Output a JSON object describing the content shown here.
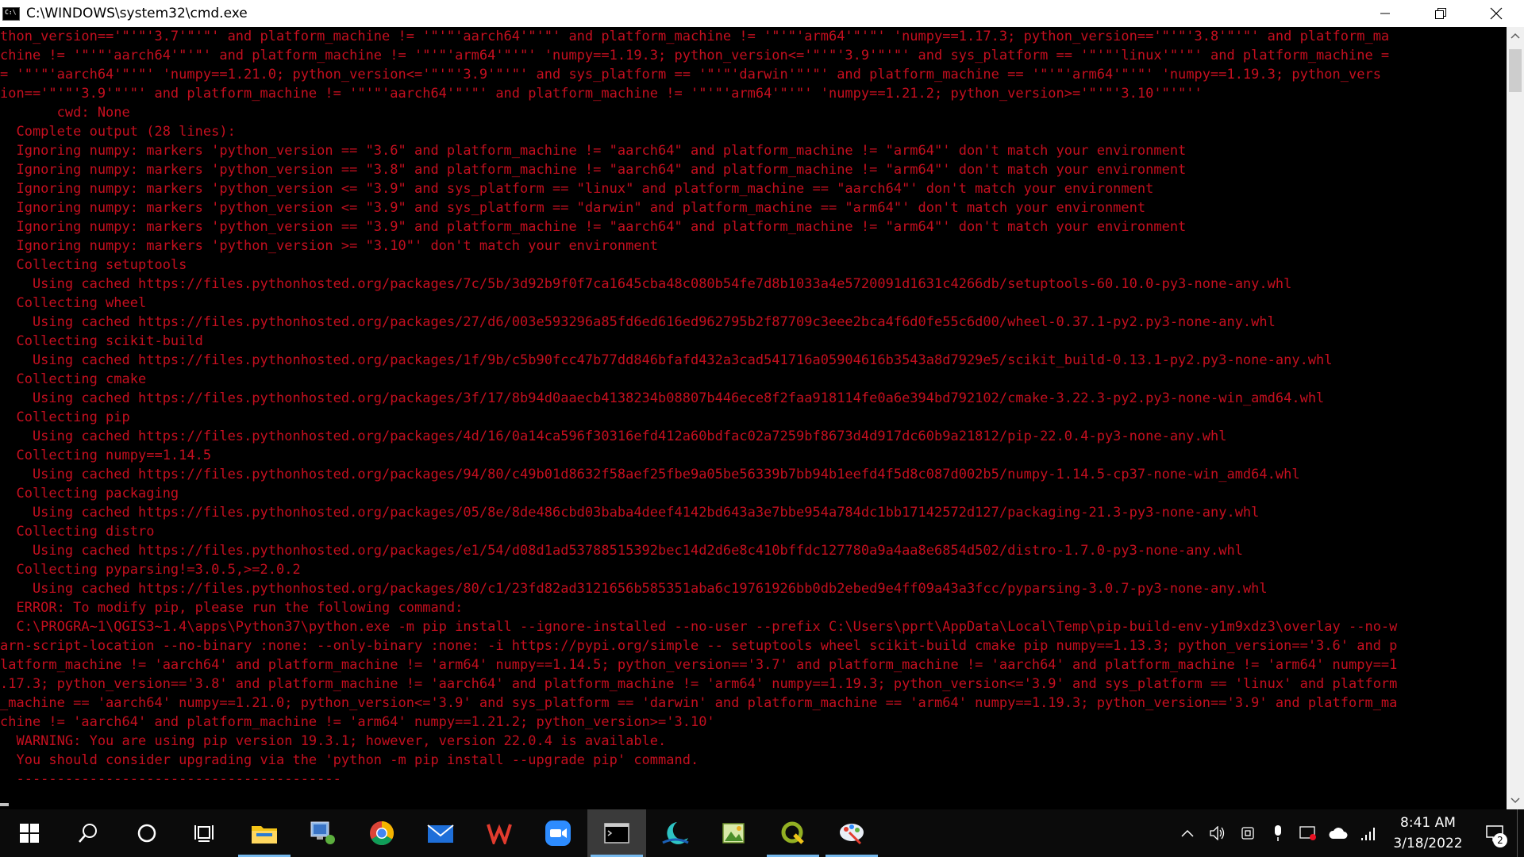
{
  "window": {
    "title": "C:\\WINDOWS\\system32\\cmd.exe",
    "controls": [
      "minimize-icon",
      "restore-icon",
      "close-icon"
    ]
  },
  "console": {
    "text_color": "#c50f1f",
    "background": "#000000",
    "lines": [
      "thon_version=='\"'\"'3.7'\"'\"' and platform_machine != '\"'\"'aarch64'\"'\"' and platform_machine != '\"'\"'arm64'\"'\"' 'numpy==1.17.3; python_version=='\"'\"'3.8'\"'\"' and platform_ma",
      "chine != '\"'\"'aarch64'\"'\"' and platform_machine != '\"'\"'arm64'\"'\"' 'numpy==1.19.3; python_version<='\"'\"'3.9'\"'\"' and sys_platform == '\"'\"'linux'\"'\"' and platform_machine =",
      "= '\"'\"'aarch64'\"'\"' 'numpy==1.21.0; python_version<='\"'\"'3.9'\"'\"' and sys_platform == '\"'\"'darwin'\"'\"' and platform_machine == '\"'\"'arm64'\"'\"' 'numpy==1.19.3; python_vers",
      "ion=='\"'\"'3.9'\"'\"' and platform_machine != '\"'\"'aarch64'\"'\"' and platform_machine != '\"'\"'arm64'\"'\"' 'numpy==1.21.2; python_version>='\"'\"'3.10'\"'\"''",
      "       cwd: None",
      "  Complete output (28 lines):",
      "  Ignoring numpy: markers 'python_version == \"3.6\" and platform_machine != \"aarch64\" and platform_machine != \"arm64\"' don't match your environment",
      "  Ignoring numpy: markers 'python_version == \"3.8\" and platform_machine != \"aarch64\" and platform_machine != \"arm64\"' don't match your environment",
      "  Ignoring numpy: markers 'python_version <= \"3.9\" and sys_platform == \"linux\" and platform_machine == \"aarch64\"' don't match your environment",
      "  Ignoring numpy: markers 'python_version <= \"3.9\" and sys_platform == \"darwin\" and platform_machine == \"arm64\"' don't match your environment",
      "  Ignoring numpy: markers 'python_version == \"3.9\" and platform_machine != \"aarch64\" and platform_machine != \"arm64\"' don't match your environment",
      "  Ignoring numpy: markers 'python_version >= \"3.10\"' don't match your environment",
      "  Collecting setuptools",
      "    Using cached https://files.pythonhosted.org/packages/7c/5b/3d92b9f0f7ca1645cba48c080b54fe7d8b1033a4e5720091d1631c4266db/setuptools-60.10.0-py3-none-any.whl",
      "  Collecting wheel",
      "    Using cached https://files.pythonhosted.org/packages/27/d6/003e593296a85fd6ed616ed962795b2f87709c3eee2bca4f6d0fe55c6d00/wheel-0.37.1-py2.py3-none-any.whl",
      "  Collecting scikit-build",
      "    Using cached https://files.pythonhosted.org/packages/1f/9b/c5b90fcc47b77dd846bfafd432a3cad541716a05904616b3543a8d7929e5/scikit_build-0.13.1-py2.py3-none-any.whl",
      "  Collecting cmake",
      "    Using cached https://files.pythonhosted.org/packages/3f/17/8b94d0aaecb4138234b08807b446ece8f2faa918114fe0a6e394bd792102/cmake-3.22.3-py2.py3-none-win_amd64.whl",
      "  Collecting pip",
      "    Using cached https://files.pythonhosted.org/packages/4d/16/0a14ca596f30316efd412a60bdfac02a7259bf8673d4d917dc60b9a21812/pip-22.0.4-py3-none-any.whl",
      "  Collecting numpy==1.14.5",
      "    Using cached https://files.pythonhosted.org/packages/94/80/c49b01d8632f58aef25fbe9a05be56339b7bb94b1eefd4f5d8c087d002b5/numpy-1.14.5-cp37-none-win_amd64.whl",
      "  Collecting packaging",
      "    Using cached https://files.pythonhosted.org/packages/05/8e/8de486cbd03baba4deef4142bd643a3e7bbe954a784dc1bb17142572d127/packaging-21.3-py3-none-any.whl",
      "  Collecting distro",
      "    Using cached https://files.pythonhosted.org/packages/e1/54/d08d1ad53788515392bec14d2d6e8c410bffdc127780a9a4aa8e6854d502/distro-1.7.0-py3-none-any.whl",
      "  Collecting pyparsing!=3.0.5,>=2.0.2",
      "    Using cached https://files.pythonhosted.org/packages/80/c1/23fd82ad3121656b585351aba6c19761926bb0db2ebed9e4ff09a43a3fcc/pyparsing-3.0.7-py3-none-any.whl",
      "  ERROR: To modify pip, please run the following command:",
      "  C:\\PROGRA~1\\QGIS3~1.4\\apps\\Python37\\python.exe -m pip install --ignore-installed --no-user --prefix C:\\Users\\pprt\\AppData\\Local\\Temp\\pip-build-env-y1m9xdz3\\overlay --no-w",
      "arn-script-location --no-binary :none: --only-binary :none: -i https://pypi.org/simple -- setuptools wheel scikit-build cmake pip numpy==1.13.3; python_version=='3.6' and p",
      "latform_machine != 'aarch64' and platform_machine != 'arm64' numpy==1.14.5; python_version=='3.7' and platform_machine != 'aarch64' and platform_machine != 'arm64' numpy==1",
      ".17.3; python_version=='3.8' and platform_machine != 'aarch64' and platform_machine != 'arm64' numpy==1.19.3; python_version<='3.9' and sys_platform == 'linux' and platform",
      "_machine == 'aarch64' numpy==1.21.0; python_version<='3.9' and sys_platform == 'darwin' and platform_machine == 'arm64' numpy==1.19.3; python_version=='3.9' and platform_ma",
      "chine != 'aarch64' and platform_machine != 'arm64' numpy==1.21.2; python_version>='3.10'",
      "  WARNING: You are using pip version 19.3.1; however, version 22.0.4 is available.",
      "  You should consider upgrading via the 'python -m pip install --upgrade pip' command.",
      "  ----------------------------------------"
    ]
  },
  "taskbar": {
    "apps": [
      {
        "name": "start-button",
        "icon": "windows-logo-icon"
      },
      {
        "name": "search-button",
        "icon": "search-icon"
      },
      {
        "name": "cortana-button",
        "icon": "circle-icon"
      },
      {
        "name": "task-view-button",
        "icon": "task-view-icon"
      },
      {
        "name": "file-explorer",
        "icon": "folder-icon"
      },
      {
        "name": "network-app",
        "icon": "computer-icon"
      },
      {
        "name": "chrome",
        "icon": "chrome-icon"
      },
      {
        "name": "mail",
        "icon": "mail-icon"
      },
      {
        "name": "wps-office",
        "icon": "w-icon"
      },
      {
        "name": "zoom",
        "icon": "video-camera-icon"
      },
      {
        "name": "command-prompt",
        "icon": "terminal-icon",
        "active": true
      },
      {
        "name": "moon-app",
        "icon": "moon-icon"
      },
      {
        "name": "image-app",
        "icon": "image-icon"
      },
      {
        "name": "qgis",
        "icon": "qgis-icon"
      },
      {
        "name": "paint-app",
        "icon": "palette-icon"
      }
    ],
    "tray": [
      "chevron-up-icon",
      "volume-icon",
      "device-icon",
      "microphone-icon",
      "screen-icon",
      "cloud-icon",
      "wifi-icon"
    ],
    "clock": {
      "time": "8:41 AM",
      "date": "3/18/2022"
    },
    "notifications": {
      "count": "2"
    }
  }
}
